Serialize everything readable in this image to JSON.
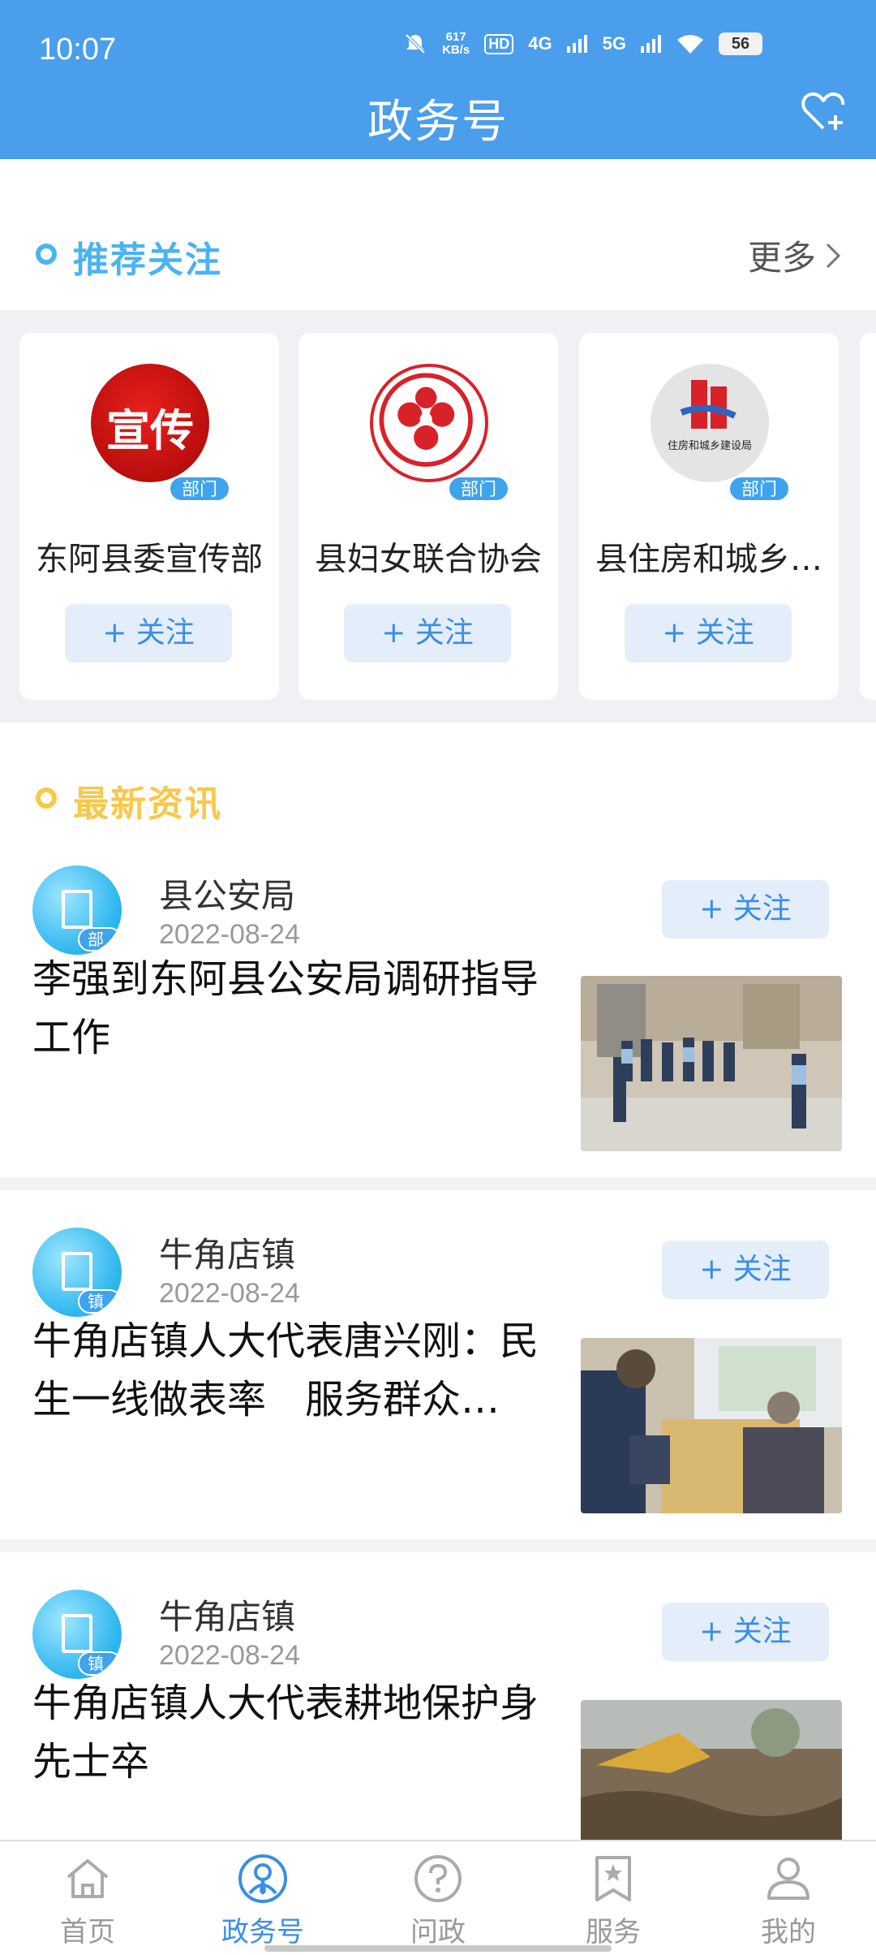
{
  "status": {
    "time": "10:07",
    "speed_top": "617",
    "speed_bottom": "KB/s",
    "network1": "4G",
    "network2": "5G",
    "battery": "56"
  },
  "header": {
    "title": "政务号",
    "fav_icon": "heart-plus-icon"
  },
  "recommended": {
    "title": "推荐关注",
    "more": "更多",
    "cards": [
      {
        "name": "东阿县委宣传部",
        "badge": "部门",
        "logo_text": "宣传",
        "follow": "+ 关注"
      },
      {
        "name": "县妇女联合协会",
        "badge": "部门",
        "logo_text": "",
        "follow": "+ 关注"
      },
      {
        "name": "县住房和城乡…",
        "badge": "部门",
        "logo_text": "住房和城乡建设局",
        "follow": "+ 关注"
      }
    ]
  },
  "news": {
    "title": "最新资讯",
    "items": [
      {
        "source": "县公安局",
        "badge": "部门",
        "date": "2022-08-24",
        "follow": "+ 关注",
        "headline": "李强到东阿县公安局调研指导工作"
      },
      {
        "source": "牛角店镇",
        "badge": "镇街",
        "date": "2022-08-24",
        "follow": "+ 关注",
        "headline": "牛角店镇人大代表唐兴刚：民生一线做表率　服务群众…"
      },
      {
        "source": "牛角店镇",
        "badge": "镇街",
        "date": "2022-08-24",
        "follow": "+ 关注",
        "headline": "牛角店镇人大代表耕地保护身先士卒"
      }
    ]
  },
  "nav": [
    {
      "label": "首页",
      "icon": "home-icon"
    },
    {
      "label": "政务号",
      "icon": "official-account-icon"
    },
    {
      "label": "问政",
      "icon": "question-icon"
    },
    {
      "label": "服务",
      "icon": "service-star-icon"
    },
    {
      "label": "我的",
      "icon": "profile-icon"
    }
  ],
  "colors": {
    "header": "#4a9eeb",
    "accent": "#3a8ee6",
    "rec_title": "#4ab3f0",
    "news_title": "#f6c84c"
  }
}
